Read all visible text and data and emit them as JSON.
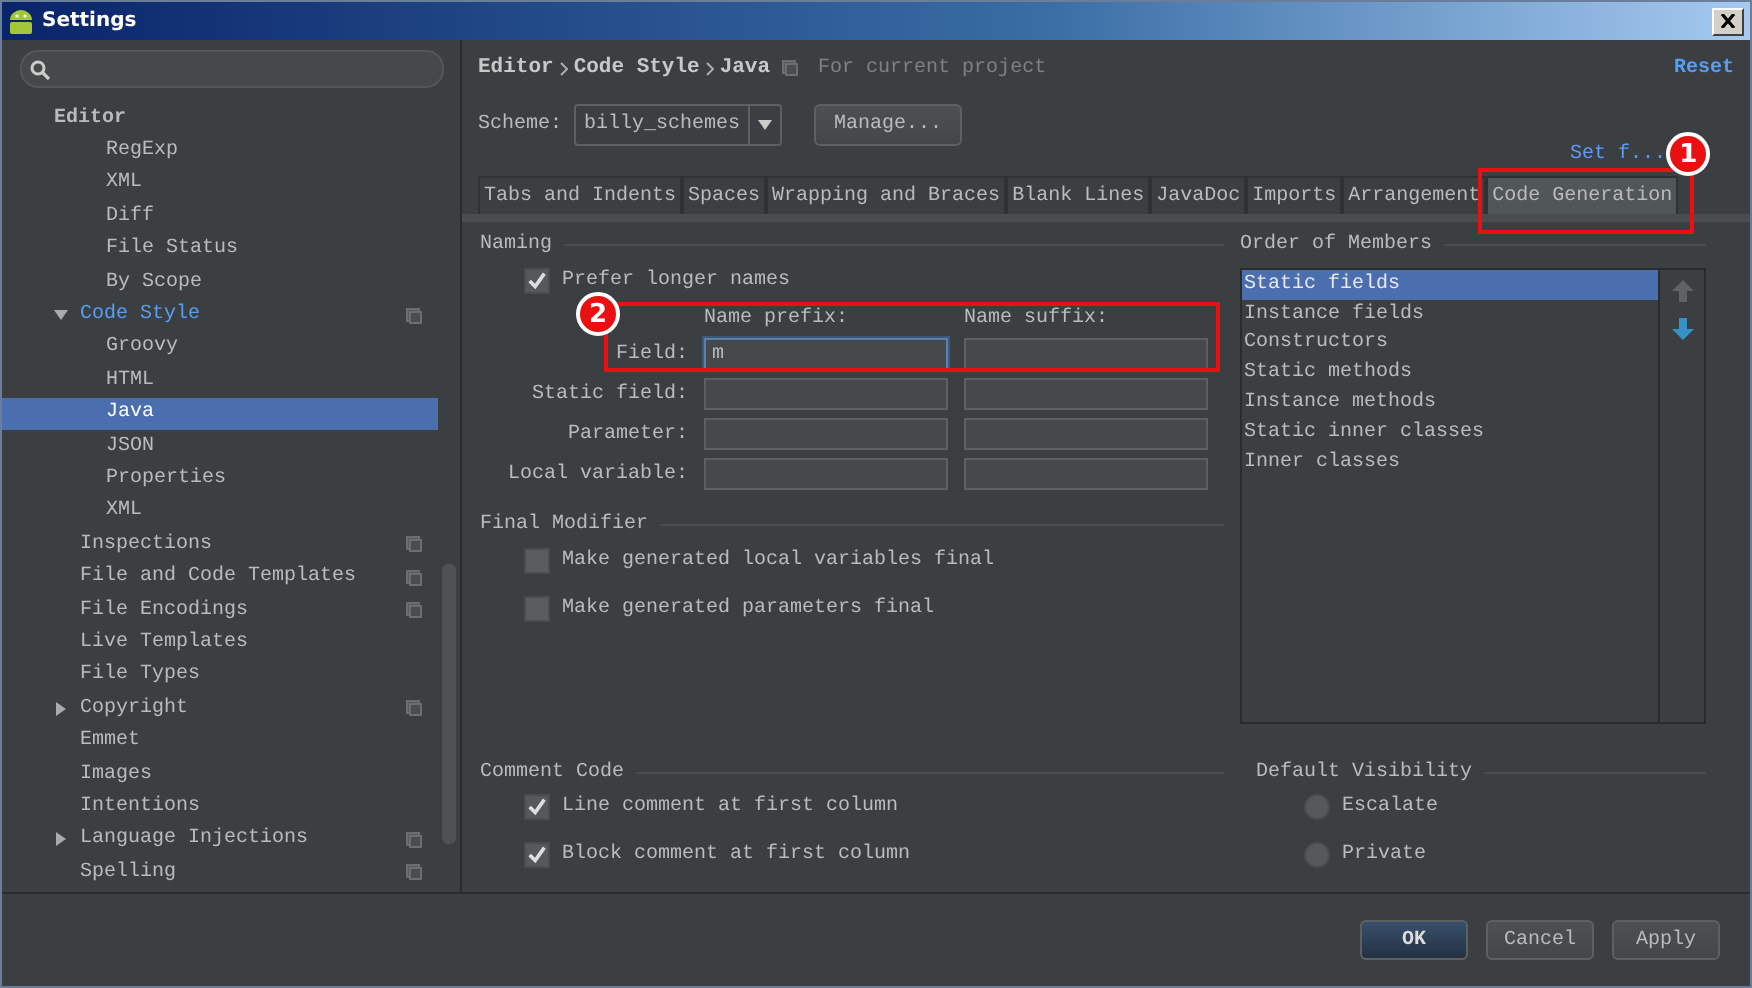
{
  "window": {
    "title": "Settings"
  },
  "sidebar": {
    "tree": [
      {
        "label": "Editor",
        "kind": "header",
        "children": [
          {
            "label": "RegExp"
          },
          {
            "label": "XML"
          },
          {
            "label": "Diff"
          },
          {
            "label": "File Status"
          },
          {
            "label": "By Scope"
          }
        ]
      },
      {
        "label": "Code Style",
        "expanded": true,
        "modified": true,
        "project_icon": true,
        "selected": false,
        "children": [
          {
            "label": "Groovy",
            "selected": false
          },
          {
            "label": "HTML",
            "selected": false
          },
          {
            "label": "Java",
            "selected": true
          },
          {
            "label": "JSON",
            "selected": false
          },
          {
            "label": "Properties",
            "selected": false
          },
          {
            "label": "XML",
            "selected": false
          }
        ]
      },
      {
        "label": "Inspections",
        "project_icon": true,
        "selected": false
      },
      {
        "label": "File and Code Templates",
        "project_icon": true,
        "selected": false
      },
      {
        "label": "File Encodings",
        "project_icon": true,
        "selected": false
      },
      {
        "label": "Live Templates",
        "selected": false
      },
      {
        "label": "File Types",
        "selected": false
      },
      {
        "label": "Copyright",
        "expanded": false,
        "project_icon": true,
        "selected": false
      },
      {
        "label": "Emmet",
        "selected": false
      },
      {
        "label": "Images",
        "selected": false
      },
      {
        "label": "Intentions",
        "selected": false
      },
      {
        "label": "Language Injections",
        "expanded": false,
        "project_icon": true,
        "selected": false
      },
      {
        "label": "Spelling",
        "project_icon": true,
        "selected": false
      }
    ]
  },
  "breadcrumb": [
    "Editor",
    "Code Style",
    "Java"
  ],
  "scope_note": "For current project",
  "reset_link": "Reset",
  "scheme": {
    "label": "Scheme:",
    "value": "billy_schemes",
    "manage_button": "Manage..."
  },
  "set_from_link": "Set f...",
  "tabs": [
    {
      "label": "Tabs and Indents",
      "selected": false
    },
    {
      "label": "Spaces",
      "selected": false
    },
    {
      "label": "Wrapping and Braces",
      "selected": false
    },
    {
      "label": "Blank Lines",
      "selected": false
    },
    {
      "label": "JavaDoc",
      "selected": false
    },
    {
      "label": "Imports",
      "selected": false
    },
    {
      "label": "Arrangement",
      "selected": false
    },
    {
      "label": "Code Generation",
      "selected": true,
      "annotation": "1"
    }
  ],
  "naming": {
    "title": "Naming",
    "prefer_longer": {
      "label": "Prefer longer names",
      "checked": true
    },
    "prefix_header": "Name prefix:",
    "suffix_header": "Name suffix:",
    "rows": [
      {
        "label": "Field:",
        "prefix": "m",
        "suffix": "",
        "focused": true,
        "annotation": "2"
      },
      {
        "label": "Static field:",
        "prefix": "",
        "suffix": "",
        "focused": false
      },
      {
        "label": "Parameter:",
        "prefix": "",
        "suffix": "",
        "focused": false
      },
      {
        "label": "Local variable:",
        "prefix": "",
        "suffix": "",
        "focused": false
      }
    ]
  },
  "final_modifier": {
    "title": "Final Modifier",
    "options": [
      {
        "label": "Make generated local variables final",
        "checked": false
      },
      {
        "label": "Make generated parameters final",
        "checked": false
      }
    ]
  },
  "order_of_members": {
    "title": "Order of Members",
    "items": [
      {
        "label": "Static fields",
        "selected": true
      },
      {
        "label": "Instance fields",
        "selected": false
      },
      {
        "label": "Constructors",
        "selected": false
      },
      {
        "label": "Static methods",
        "selected": false
      },
      {
        "label": "Instance methods",
        "selected": false
      },
      {
        "label": "Static inner classes",
        "selected": false
      },
      {
        "label": "Inner classes",
        "selected": false
      }
    ]
  },
  "comment_code": {
    "title": "Comment Code",
    "options": [
      {
        "label": "Line comment at first column",
        "checked": true
      },
      {
        "label": "Block comment at first column",
        "checked": true
      }
    ]
  },
  "default_visibility": {
    "title": "Default Visibility",
    "options": [
      {
        "label": "Escalate",
        "selected": false
      },
      {
        "label": "Private",
        "selected": false
      }
    ]
  },
  "buttons": [
    {
      "label": "OK",
      "kind": "default"
    },
    {
      "label": "Cancel",
      "kind": "normal"
    },
    {
      "label": "Apply",
      "kind": "normal"
    }
  ]
}
